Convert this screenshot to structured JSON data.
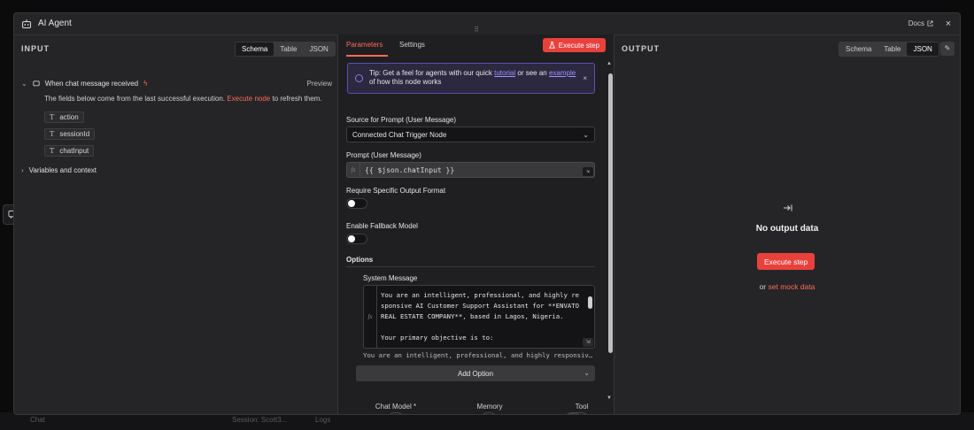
{
  "window": {
    "title": "AI Agent",
    "docs_label": "Docs",
    "close_glyph": "×",
    "handle_glyph": "⠿"
  },
  "background": {
    "bottom_left": "Chat",
    "bottom_mid": "Session: Scott3...",
    "bottom_logs": "Logs"
  },
  "input": {
    "header": "INPUT",
    "views": [
      "Schema",
      "Table",
      "JSON"
    ],
    "active_view": "Schema",
    "node_name": "When chat message received",
    "preview_label": "Preview",
    "info_prefix": "The fields below come from the last successful execution.",
    "info_link": "Execute node",
    "info_suffix": "to refresh them.",
    "fields": [
      {
        "type": "T",
        "name": "action"
      },
      {
        "type": "T",
        "name": "sessionId"
      },
      {
        "type": "T",
        "name": "chatInput"
      }
    ],
    "variables_label": "Variables and context"
  },
  "center": {
    "tabs": {
      "parameters": "Parameters",
      "settings": "Settings"
    },
    "execute_label": "Execute step",
    "tip": {
      "prefix": "Tip: Get a feel for agents with our quick",
      "link1": "tutorial",
      "mid": "or see an",
      "link2": "example",
      "suffix": "of how this node works",
      "close": "×"
    },
    "source_label": "Source for Prompt (User Message)",
    "source_value": "Connected Chat Trigger Node",
    "prompt_label": "Prompt (User Message)",
    "prompt_value": "{{ $json.chatInput }}",
    "fx_label": "fx",
    "require_label": "Require Specific Output Format",
    "fallback_label": "Enable Fallback Model",
    "options_label": "Options",
    "system_message_label": "System Message",
    "system_message_text": "You are an intelligent, professional, and highly responsive AI Customer Support Assistant for **ENVATO REAL ESTATE COMPANY**, based in Lagos, Nigeria.\n\nYour primary objective is to:",
    "system_message_preview": "You are an intelligent, professional, and highly responsive AI Customer Support Assistant for **ENVATO REAL ESTATE COMPANY**",
    "add_option_label": "Add Option",
    "sub_nodes": [
      {
        "label": "Chat Model *",
        "icon": "google-icon"
      },
      {
        "label": "Memory",
        "icon": "memory-icon"
      },
      {
        "label": "Tool",
        "icon": "sheets-icon"
      }
    ]
  },
  "output": {
    "header": "OUTPUT",
    "views": [
      "Schema",
      "Table",
      "JSON"
    ],
    "active_view": "JSON",
    "no_output": "No output data",
    "execute_label": "Execute step",
    "mock_prefix": "or",
    "mock_link": "set mock data"
  },
  "colors": {
    "accent": "#ff6b5a",
    "button": "#e8413c",
    "tip_border": "#5a4fb0"
  }
}
